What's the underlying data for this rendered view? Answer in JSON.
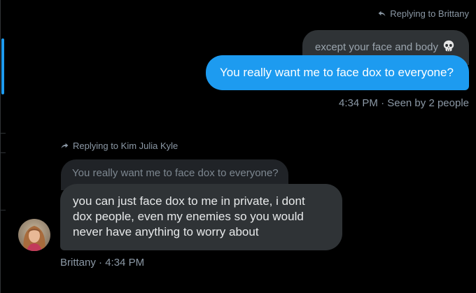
{
  "thread": {
    "outgoing": {
      "reply_to_label": "Replying to Brittany",
      "quoted_text": "except your face and body",
      "quoted_emoji": "skull-icon",
      "message": "You really want me to face dox to everyone?",
      "time": "4:34 PM",
      "separator": "·",
      "seen": "Seen by 2 people"
    },
    "incoming": {
      "reply_to_label": "Replying to Kim Julia Kyle",
      "quoted_text": "You really want me to face dox to everyone?",
      "message_lines": [
        "you can just face dox to me in private, i dont",
        "dox people, even my enemies so you would",
        "never have anything to worry about"
      ],
      "sender": "Brittany",
      "separator": "·",
      "time": "4:34 PM"
    }
  },
  "colors": {
    "background": "#000000",
    "outgoing_bubble": "#1d9bf0",
    "incoming_bubble": "#2f3336",
    "muted_text": "#8b98a5"
  }
}
